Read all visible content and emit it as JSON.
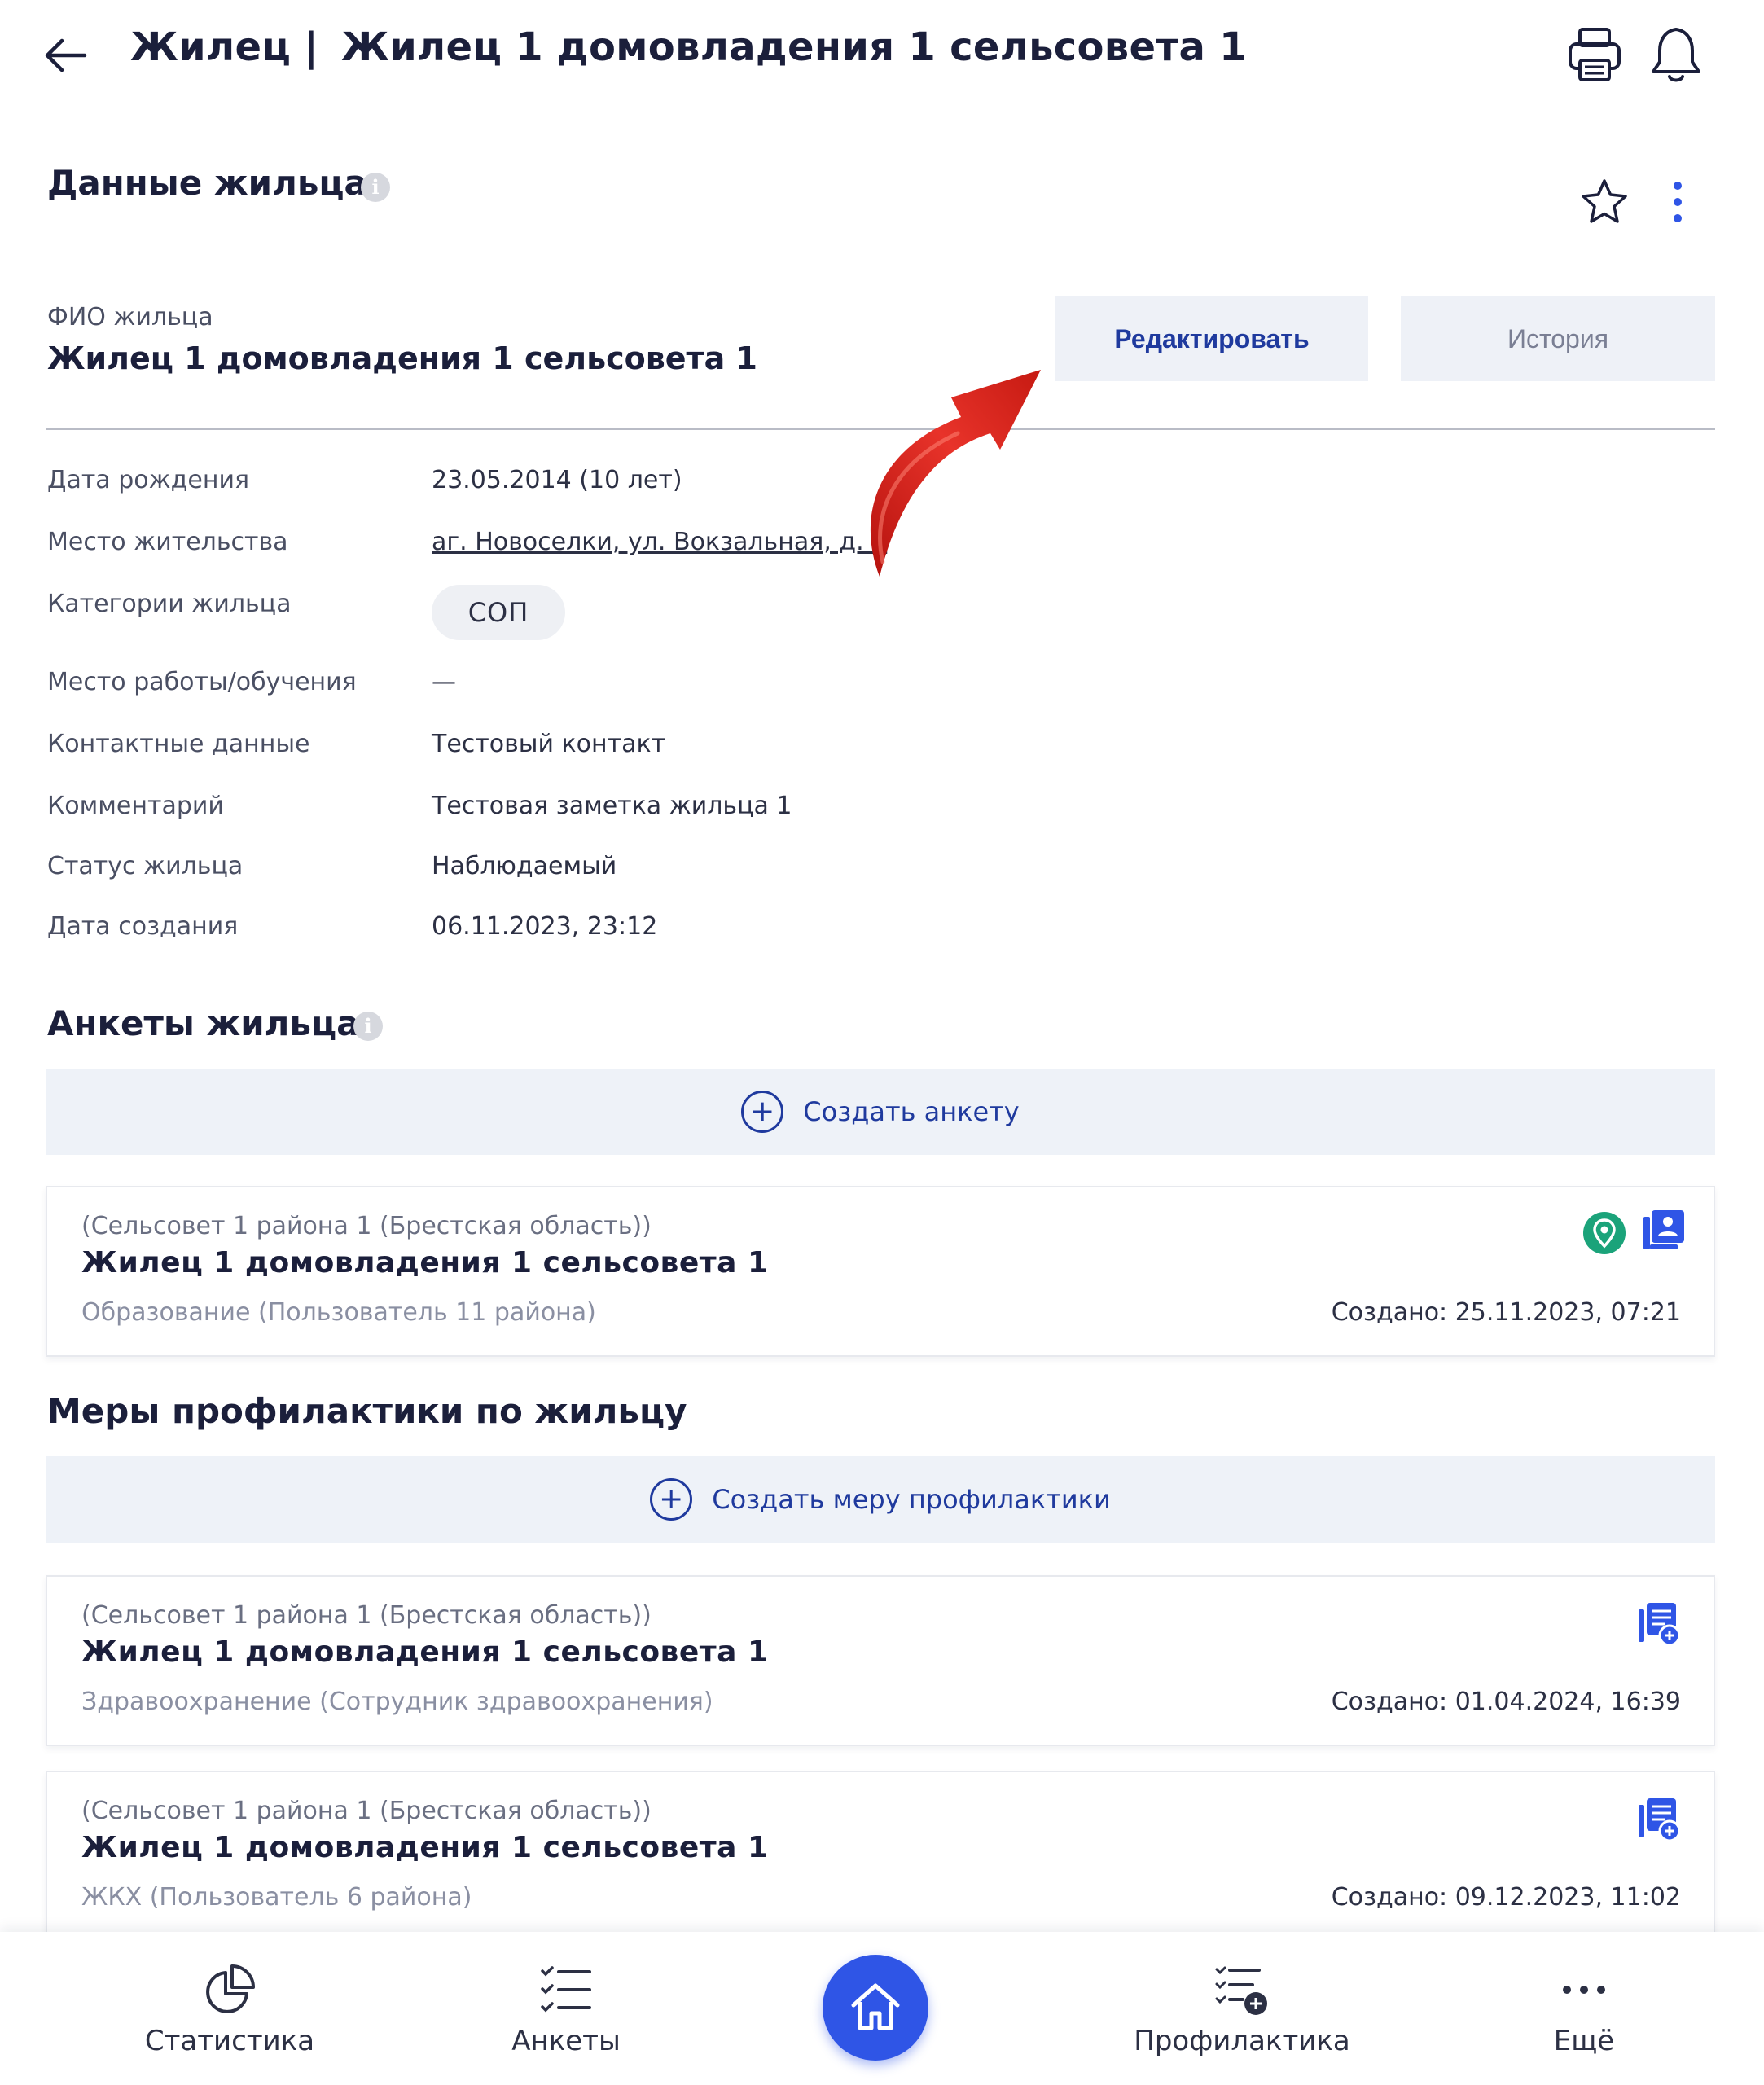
{
  "header": {
    "title_prefix": "Жилец",
    "separator": "|",
    "title": "Жилец 1 домовладения 1 сельсовета 1"
  },
  "resident_section": {
    "title": "Данные жильца",
    "fio_label": "ФИО жильца",
    "fio_value": "Жилец 1 домовладения 1 сельсовета 1",
    "edit_label": "Редактировать",
    "history_label": "История"
  },
  "details": [
    {
      "label": "Дата рождения",
      "value": "23.05.2014 (10 лет)"
    },
    {
      "label": "Место жительства",
      "value": "аг. Новоселки, ул. Вокзальная, д. 1"
    },
    {
      "label": "Категории жильца",
      "value": "СОП"
    },
    {
      "label": "Место работы/обучения",
      "value": "—"
    },
    {
      "label": "Контактные данные",
      "value": "Тестовый контакт"
    },
    {
      "label": "Комментарий",
      "value": "Тестовая заметка жильца 1"
    },
    {
      "label": "Статус жильца",
      "value": "Наблюдаемый"
    },
    {
      "label": "Дата создания",
      "value": "06.11.2023, 23:12"
    }
  ],
  "questionnaires": {
    "title": "Анкеты жильца",
    "create_label": "Создать анкету",
    "items": [
      {
        "org": "(Сельсовет 1 района 1 (Брестская область))",
        "name": "Жилец 1 домовладения 1 сельсовета 1",
        "sub": "Образование (Пользователь 11 района)",
        "date": "Создано: 25.11.2023, 07:21"
      }
    ]
  },
  "prevention": {
    "title": "Меры профилактики по жильцу",
    "create_label": "Создать меру профилактики",
    "items": [
      {
        "org": "(Сельсовет 1 района 1 (Брестская область))",
        "name": "Жилец 1 домовладения 1 сельсовета 1",
        "sub": "Здравоохранение (Сотрудник здравоохранения)",
        "date": "Создано: 01.04.2024, 16:39"
      },
      {
        "org": "(Сельсовет 1 района 1 (Брестская область))",
        "name": "Жилец 1 домовладения 1 сельсовета 1",
        "sub": "ЖКХ (Пользователь 6 района)",
        "date": "Создано: 09.12.2023, 11:02"
      }
    ]
  },
  "nav": {
    "stats": "Статистика",
    "forms": "Анкеты",
    "prevention": "Профилактика",
    "more": "Ещё"
  },
  "colors": {
    "accent": "#2f55e6",
    "link_blue": "#1f3a9e",
    "pin_green": "#1ba37a",
    "arrow_red": "#d8261c"
  }
}
